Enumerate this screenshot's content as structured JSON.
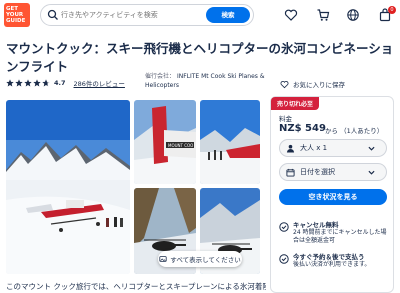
{
  "header": {
    "logo_text": "GET\nYOUR\nGUIDE",
    "search_placeholder": "行き先やアクティビティを検索",
    "search_button": "検索",
    "cart_badge": "0"
  },
  "title": "マウントクック：スキー飛行機とヘリコプターの氷河コンビネーションフライト",
  "rating": {
    "score": "4.7",
    "stars": 5,
    "reviews": "286件のレビュー"
  },
  "operator": {
    "label": "催行会社：",
    "name": "INFLITE Mt Cook Ski Planes & Helicopters"
  },
  "actions": {
    "wishlist": "お気に入りに保存",
    "share": "共有"
  },
  "gallery": {
    "show_all": "すべて表示してください"
  },
  "description": "このマウント クック旅行では、ヘリコプターとスキープレーンによる氷河着陸を",
  "booking": {
    "ribbon": "売り切れ必至",
    "price_label": "料金",
    "price": "NZ$ 549",
    "price_suffix": "から （1人あたり）",
    "participants": "大人 x 1",
    "date": "日付を選択",
    "cta": "空き状況を見る",
    "features": [
      {
        "title": "キャンセル無料",
        "desc": "24 時間前までにキャンセルした場合は全額返金可"
      },
      {
        "title": "今すぐ予約＆後で支払う",
        "desc": "後払い決済が利用できます。"
      }
    ]
  },
  "colors": {
    "brand": "#ff5533",
    "accent": "#0071eb",
    "ribbon": "#d4213d",
    "text": "#1a2b49"
  }
}
